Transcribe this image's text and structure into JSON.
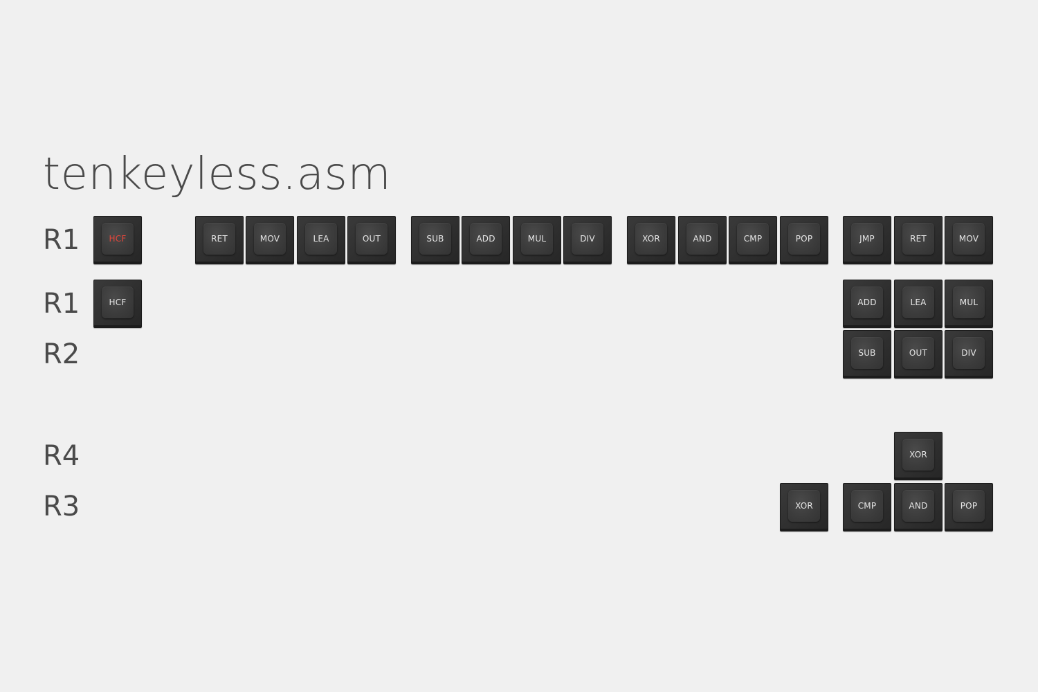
{
  "title": "tenkeyless.asm",
  "accent_color": "#e5463b",
  "legend_color": "#e6e6e6",
  "row_labels": [
    "R1",
    "R1",
    "R2",
    "R4",
    "R3"
  ],
  "keys": [
    {
      "label": "HCF",
      "accent": true
    },
    {
      "label": "RET"
    },
    {
      "label": "MOV"
    },
    {
      "label": "LEA"
    },
    {
      "label": "OUT"
    },
    {
      "label": "SUB"
    },
    {
      "label": "ADD"
    },
    {
      "label": "MUL"
    },
    {
      "label": "DIV"
    },
    {
      "label": "XOR"
    },
    {
      "label": "AND"
    },
    {
      "label": "CMP"
    },
    {
      "label": "POP"
    },
    {
      "label": "JMP"
    },
    {
      "label": "RET"
    },
    {
      "label": "MOV"
    },
    {
      "label": "HCF"
    },
    {
      "label": "ADD"
    },
    {
      "label": "LEA"
    },
    {
      "label": "MUL"
    },
    {
      "label": "SUB"
    },
    {
      "label": "OUT"
    },
    {
      "label": "DIV"
    },
    {
      "label": "XOR"
    },
    {
      "label": "XOR"
    },
    {
      "label": "CMP"
    },
    {
      "label": "AND"
    },
    {
      "label": "POP"
    }
  ]
}
